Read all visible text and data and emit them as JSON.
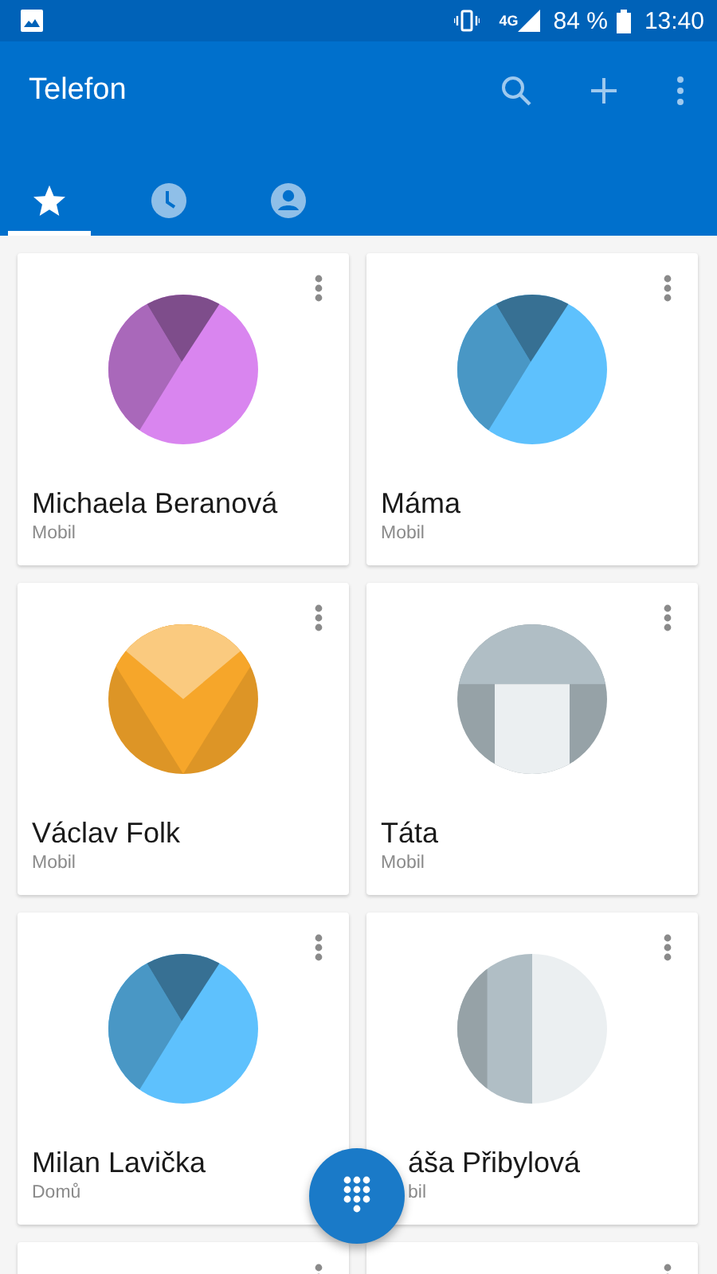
{
  "status_bar": {
    "network": "4G",
    "battery": "84 %",
    "time": "13:40"
  },
  "app_bar": {
    "title": "Telefon"
  },
  "tabs": [
    {
      "kind": "star",
      "selected": true
    },
    {
      "kind": "clock",
      "selected": false
    },
    {
      "kind": "person",
      "selected": false
    }
  ],
  "favorites": [
    {
      "name": "Michaela Beranová",
      "label": "Mobil",
      "avatar": {
        "kind": "pie",
        "color": "#d985ef"
      }
    },
    {
      "name": "Máma",
      "label": "Mobil",
      "avatar": {
        "kind": "pie",
        "color": "#5ec1fd"
      }
    },
    {
      "name": "Václav Folk",
      "label": "Mobil",
      "avatar": {
        "kind": "chevron",
        "color": "#f6a62a"
      }
    },
    {
      "name": "Táta",
      "label": "Mobil",
      "avatar": {
        "kind": "person",
        "color": "#b0bec5"
      }
    },
    {
      "name": "Milan Lavička",
      "label": "Domů",
      "avatar": {
        "kind": "pie",
        "color": "#5ec1fd"
      }
    },
    {
      "name": "áša Přibylová",
      "label": "bil",
      "covered": true,
      "avatar": {
        "kind": "stripes",
        "color": "#b0bec5"
      }
    },
    {
      "cut_off": true
    },
    {
      "cut_off": true
    }
  ]
}
